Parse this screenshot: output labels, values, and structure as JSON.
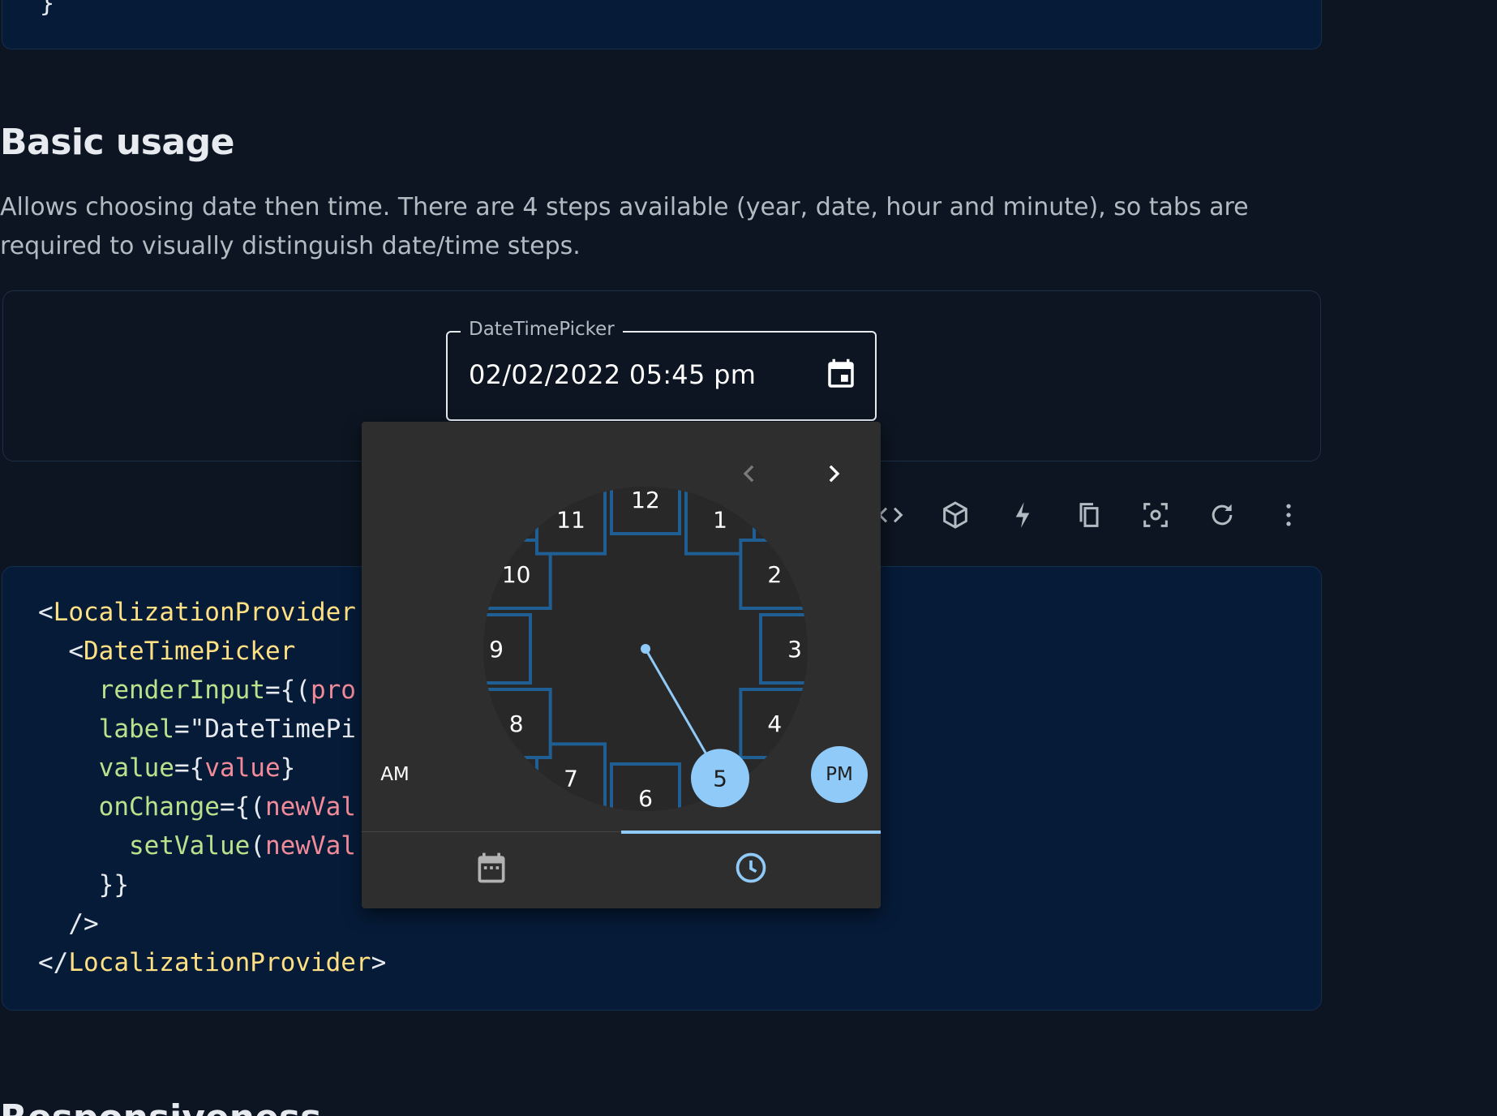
{
  "top_code": {
    "closing_brace": "}"
  },
  "section": {
    "title": "Basic usage",
    "description": "Allows choosing date then time. There are 4 steps available (year, date, hour and minute), so tabs are required to visually distinguish date/time steps."
  },
  "picker": {
    "label": "DateTimePicker",
    "value": "02/02/2022 05:45 pm",
    "calendar_icon": "calendar-event-icon"
  },
  "clock": {
    "hours": [
      "12",
      "1",
      "2",
      "3",
      "4",
      "5",
      "6",
      "7",
      "8",
      "9",
      "10",
      "11"
    ],
    "selected_hour": "5",
    "am_label": "AM",
    "pm_label": "PM",
    "selected_period": "PM",
    "accent_color": "#90caf9",
    "focus_outline_color": "#1f5f94"
  },
  "tabs": [
    {
      "name": "date",
      "icon": "calendar-icon",
      "selected": false
    },
    {
      "name": "time",
      "icon": "clock-icon",
      "selected": true
    }
  ],
  "toolbar_icons": [
    "code-icon",
    "codesandbox-icon",
    "stackblitz-icon",
    "copy-icon",
    "reset-focus-icon",
    "reset-icon",
    "more-icon"
  ],
  "code": {
    "lines": [
      {
        "indent": "",
        "parts": [
          [
            "p",
            "<"
          ],
          [
            "t",
            "LocalizationProvider"
          ]
        ]
      },
      {
        "indent": "  ",
        "parts": [
          [
            "p",
            "<"
          ],
          [
            "t",
            "DateTimePicker"
          ]
        ]
      },
      {
        "indent": "    ",
        "parts": [
          [
            "a",
            "renderInput"
          ],
          [
            "p",
            "={("
          ],
          [
            "v",
            "pro"
          ]
        ]
      },
      {
        "indent": "    ",
        "parts": [
          [
            "a",
            "label"
          ],
          [
            "p",
            "=\"DateTimePi"
          ]
        ]
      },
      {
        "indent": "    ",
        "parts": [
          [
            "a",
            "value"
          ],
          [
            "p",
            "={"
          ],
          [
            "v",
            "value"
          ],
          [
            "p",
            "}"
          ]
        ]
      },
      {
        "indent": "    ",
        "parts": [
          [
            "a",
            "onChange"
          ],
          [
            "p",
            "={("
          ],
          [
            "v",
            "newVal"
          ]
        ]
      },
      {
        "indent": "      ",
        "parts": [
          [
            "a",
            "setValue"
          ],
          [
            "p",
            "("
          ],
          [
            "v",
            "newVal"
          ]
        ]
      },
      {
        "indent": "    ",
        "parts": [
          [
            "p",
            "}}"
          ]
        ]
      },
      {
        "indent": "  ",
        "parts": [
          [
            "p",
            "/>"
          ]
        ]
      },
      {
        "indent": "",
        "parts": [
          [
            "p",
            "</"
          ],
          [
            "t",
            "LocalizationProvider"
          ],
          [
            "p",
            ">"
          ]
        ]
      }
    ]
  },
  "next_section": {
    "title": "Responsiveness"
  }
}
